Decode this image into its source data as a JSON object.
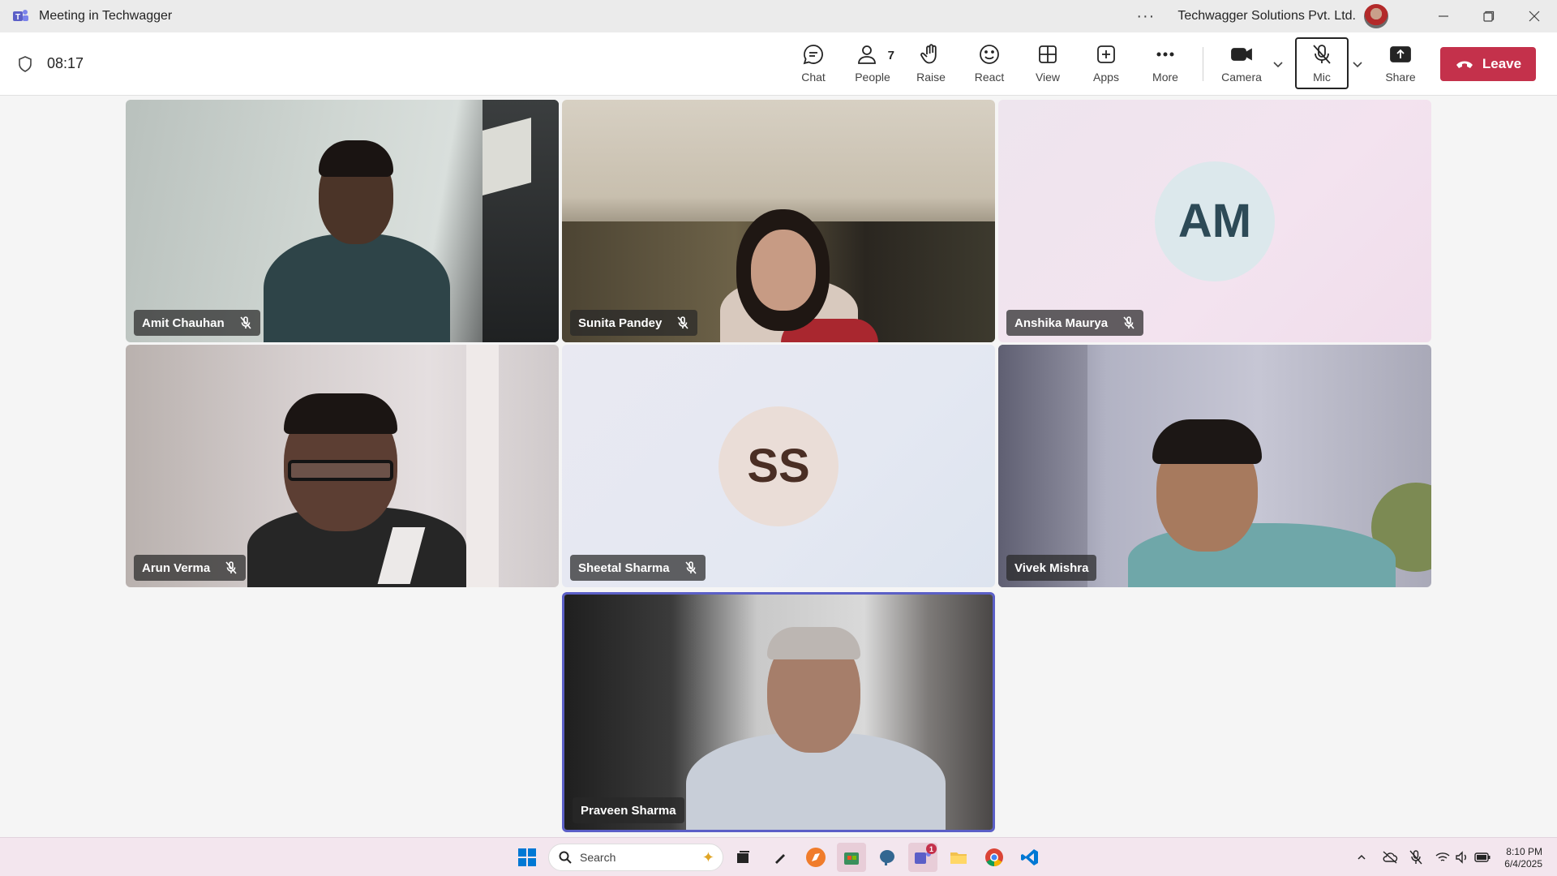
{
  "window": {
    "title": "Meeting in Techwagger",
    "organization": "Techwagger Solutions Pvt. Ltd.",
    "more_icon": "ellipsis-icon"
  },
  "toolbar": {
    "timer": "08:17",
    "buttons": {
      "chat": "Chat",
      "people": "People",
      "people_count": "7",
      "raise": "Raise",
      "react": "React",
      "view": "View",
      "apps": "Apps",
      "more": "More",
      "camera": "Camera",
      "mic": "Mic",
      "share": "Share"
    },
    "leave": "Leave"
  },
  "participants": [
    {
      "name": "Amit Chauhan",
      "muted": true,
      "video": true
    },
    {
      "name": "Sunita Pandey",
      "muted": true,
      "video": true
    },
    {
      "name": "Anshika Maurya",
      "muted": true,
      "video": false,
      "initials": "AM"
    },
    {
      "name": "Arun Verma",
      "muted": true,
      "video": true
    },
    {
      "name": "Sheetal Sharma",
      "muted": true,
      "video": false,
      "initials": "SS"
    },
    {
      "name": "Vivek Mishra",
      "muted": false,
      "video": true
    },
    {
      "name": "Praveen Sharma",
      "muted": false,
      "video": true,
      "speaking": true
    }
  ],
  "taskbar": {
    "search_placeholder": "Search",
    "teams_badge": "1",
    "time": "8:10 PM",
    "date": "6/4/2025"
  },
  "colors": {
    "accent": "#5b5fc7",
    "leave": "#c4314b"
  }
}
